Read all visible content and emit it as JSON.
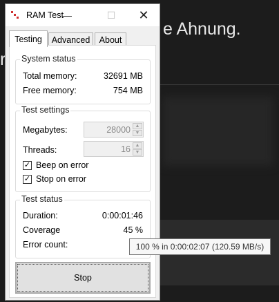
{
  "background": {
    "text_line1": "e Ahnung.",
    "text_line2": "r"
  },
  "window": {
    "title": "RAM Test",
    "controls": {
      "minimize": "—",
      "maximize": "☐",
      "close": "✕"
    }
  },
  "tabs": [
    {
      "label": "Testing",
      "active": true
    },
    {
      "label": "Advanced",
      "active": false
    },
    {
      "label": "About",
      "active": false
    }
  ],
  "system_status": {
    "label": "System status",
    "total_memory_label": "Total memory:",
    "total_memory_value": "32691 MB",
    "free_memory_label": "Free memory:",
    "free_memory_value": "754 MB"
  },
  "test_settings": {
    "label": "Test settings",
    "megabytes_label": "Megabytes:",
    "megabytes_value": "28000",
    "threads_label": "Threads:",
    "threads_value": "16",
    "beep_on_error_label": "Beep on error",
    "beep_on_error_checked": true,
    "stop_on_error_label": "Stop on error",
    "stop_on_error_checked": true
  },
  "test_status": {
    "label": "Test status",
    "duration_label": "Duration:",
    "duration_value": "0:00:01:46",
    "coverage_label": "Coverage",
    "coverage_value": "45 %",
    "error_count_label": "Error count:",
    "error_count_value": ""
  },
  "stop_button": {
    "label": "Stop"
  },
  "tooltip": {
    "text": "100 % in 0:00:02:07 (120.59 MB/s)"
  },
  "colors": {
    "accent_close_icon_red": "#d03030",
    "window_bg": "#f0f0f0",
    "desktop_bg": "#1c1c1c"
  }
}
